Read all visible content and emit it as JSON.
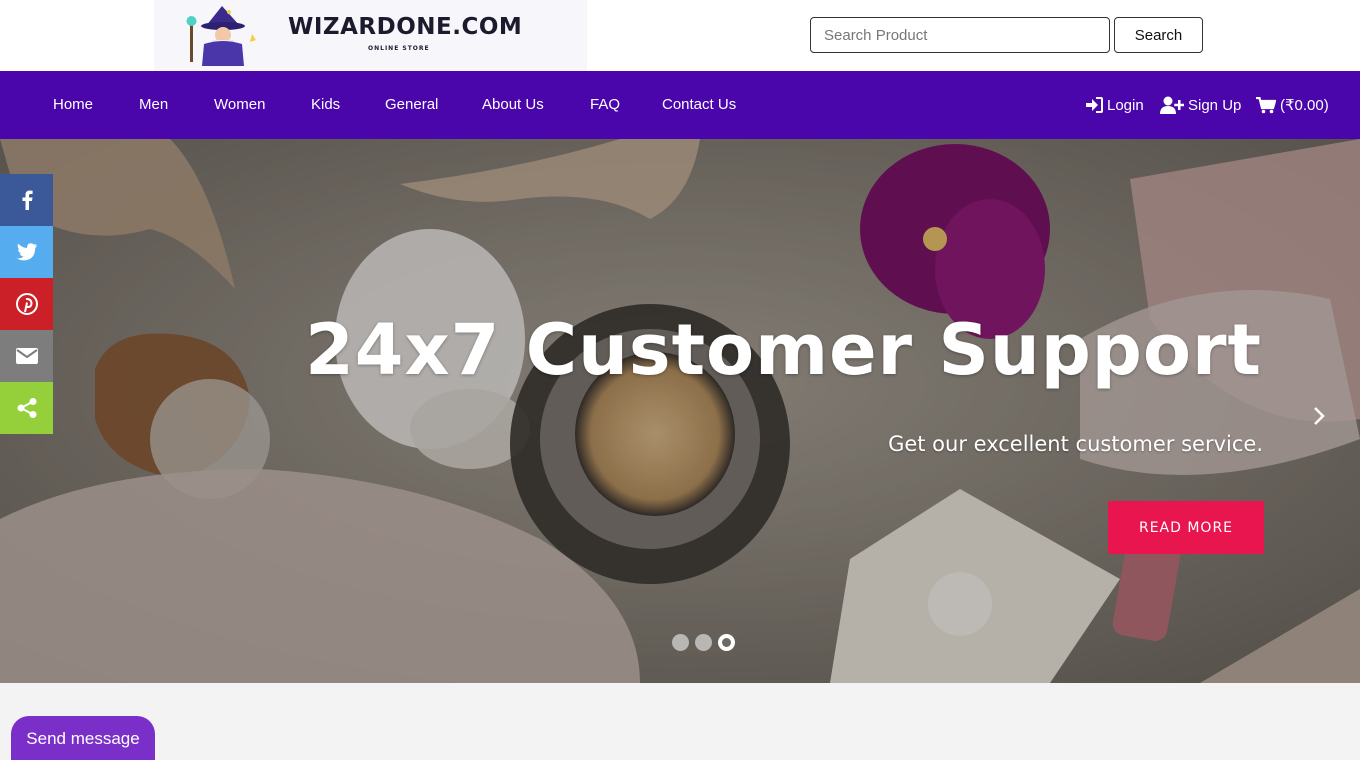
{
  "header": {
    "logo_text": "WIZARDONE.COM",
    "logo_subtext": "ONLINE STORE",
    "search_placeholder": "Search Product",
    "search_button": "Search"
  },
  "nav": {
    "items": [
      {
        "label": "Home"
      },
      {
        "label": "Men"
      },
      {
        "label": "Women"
      },
      {
        "label": "Kids"
      },
      {
        "label": "General"
      },
      {
        "label": "About Us"
      },
      {
        "label": "FAQ"
      },
      {
        "label": "Contact Us"
      }
    ],
    "login": "Login",
    "signup": "Sign Up",
    "cart": "(₹0.00)"
  },
  "hero": {
    "title": "24x7 Customer Support",
    "subtitle": "Get our excellent customer service.",
    "button": "READ MORE",
    "slide_count": 3,
    "active_slide": 3
  },
  "social": [
    "facebook-icon",
    "twitter-icon",
    "pinterest-icon",
    "email-icon",
    "share-icon"
  ],
  "colors": {
    "nav_bg": "#4a05ab",
    "cta": "#e8154f",
    "facebook": "#3b5998",
    "twitter": "#55acee",
    "pinterest": "#cb2027",
    "email": "#7d7d7d",
    "share": "#95d03a",
    "send_message": "#7b2fc9"
  },
  "chat": {
    "label": "Send message"
  }
}
